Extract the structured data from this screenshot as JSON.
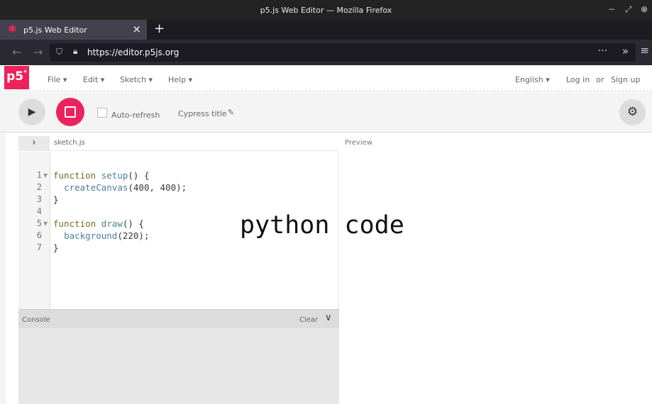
{
  "window": {
    "title": "p5.js Web Editor — Mozilla Firefox",
    "controls": [
      "−",
      "⤢",
      "⊗"
    ]
  },
  "browser": {
    "tab": {
      "title": "p5.js Web Editor",
      "close": "×"
    },
    "new_tab": "+",
    "url": "https://editor.p5js.org",
    "more_actions": "···",
    "overflow": "»",
    "menu": "≡"
  },
  "app": {
    "logo": {
      "text": "p5",
      "superscript": "*"
    },
    "menu": [
      {
        "label": "File ▾"
      },
      {
        "label": "Edit ▾"
      },
      {
        "label": "Sketch ▾"
      },
      {
        "label": "Help ▾"
      }
    ],
    "language": "English ▾",
    "login": "Log in",
    "or": "or",
    "signup": "Sign up"
  },
  "toolbar": {
    "autorefresh_label": "Auto-refresh",
    "autorefresh_checked": false,
    "sketch_name": "Cypress title",
    "pencil": "✎",
    "settings": "⚙"
  },
  "editor": {
    "expand": "›",
    "filename": "sketch.js",
    "lines": [
      {
        "n": "1",
        "fold": true
      },
      {
        "n": "2",
        "fold": false
      },
      {
        "n": "3",
        "fold": false
      },
      {
        "n": "4",
        "fold": false
      },
      {
        "n": "5",
        "fold": true
      },
      {
        "n": "6",
        "fold": false
      },
      {
        "n": "7",
        "fold": false
      }
    ],
    "code": {
      "l1_kw": "function",
      "l1_fn": "setup",
      "l1_rest": "() {",
      "l2_fn": "createCanvas",
      "l2_rest": "(400, 400);",
      "l3": "}",
      "l5_kw": "function",
      "l5_fn": "draw",
      "l5_rest": "() {",
      "l6_fn": "background",
      "l6_rest": "(220);",
      "l7": "}"
    }
  },
  "overlay_text": "python code",
  "preview": {
    "label": "Preview"
  },
  "console": {
    "label": "Console",
    "clear": "Clear",
    "chevron": "∨"
  },
  "colors": {
    "accent": "#ed225d",
    "toolbar_bg": "#f4f4f4",
    "browser_dark": "#2b2a33"
  }
}
